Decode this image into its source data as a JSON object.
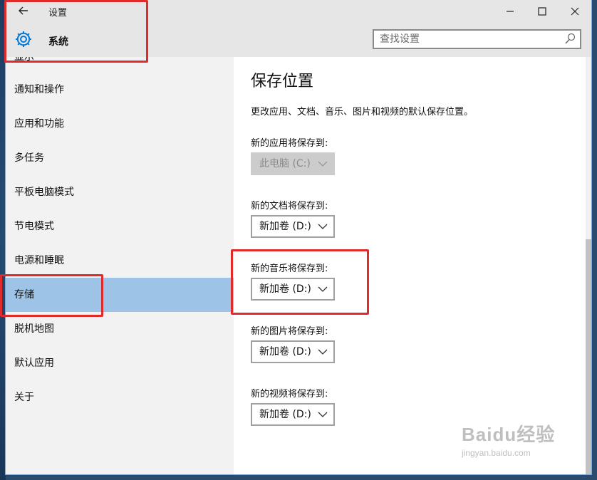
{
  "window": {
    "title": "设置",
    "back_label": "←",
    "minimize": "–",
    "maximize": "☐",
    "close": "✕",
    "section_title": "系统",
    "search": {
      "placeholder": "查找设置"
    }
  },
  "sidebar": {
    "partial_item": "显示",
    "items": [
      {
        "label": "通知和操作"
      },
      {
        "label": "应用和功能"
      },
      {
        "label": "多任务"
      },
      {
        "label": "平板电脑模式"
      },
      {
        "label": "节电模式"
      },
      {
        "label": "电源和睡眠"
      },
      {
        "label": "存储",
        "active": true
      },
      {
        "label": "脱机地图"
      },
      {
        "label": "默认应用"
      },
      {
        "label": "关于"
      }
    ]
  },
  "content": {
    "title": "保存位置",
    "description": "更改应用、文档、音乐、图片和视频的默认保存位置。",
    "fields": [
      {
        "label": "新的应用将保存到:",
        "value": "此电脑 (C:)",
        "disabled": true
      },
      {
        "label": "新的文档将保存到:",
        "value": "新加卷 (D:)"
      },
      {
        "label": "新的音乐将保存到:",
        "value": "新加卷 (D:)"
      },
      {
        "label": "新的图片将保存到:",
        "value": "新加卷 (D:)"
      },
      {
        "label": "新的视频将保存到:",
        "value": "新加卷 (D:)"
      }
    ]
  },
  "watermark": {
    "brand": "Baidu经验",
    "url": "jingyan.baidu.com"
  },
  "colors": {
    "accent": "#0078d7",
    "active_item": "#9dc3e6",
    "annotation": "#e12b2b",
    "header_bg": "#e6e6e6",
    "sidebar_bg": "#f2f2f2"
  },
  "icons": {
    "back": "arrow-left-icon",
    "system": "gear-icon",
    "search": "search-icon",
    "dropdown": "chevron-down-icon"
  }
}
